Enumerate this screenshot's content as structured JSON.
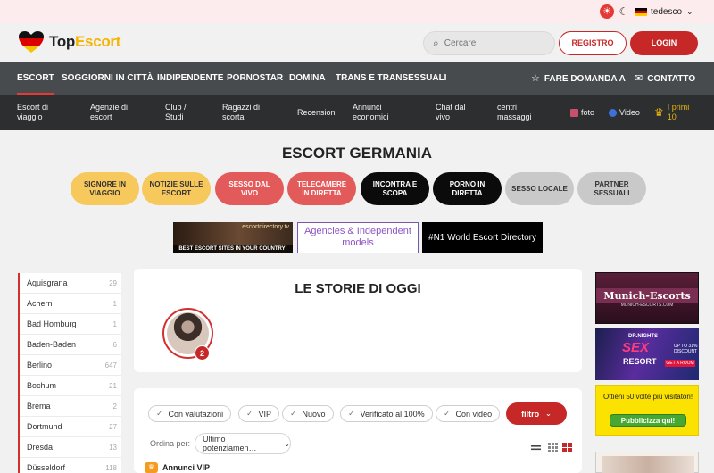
{
  "topbar": {
    "language": "tedesco"
  },
  "header": {
    "logo_part1": "Top",
    "logo_part2": "Escort",
    "search_placeholder": "Cercare",
    "register_label": "REGISTRO",
    "login_label": "LOGIN"
  },
  "nav": {
    "items": [
      "ESCORT",
      "SOGGIORNI IN CITTÀ",
      "INDIPENDENTE",
      "PORNOSTAR",
      "DOMINA",
      "TRANS E TRANSESSUALI"
    ],
    "ask_label": "FARE DOMANDA A",
    "contact_label": "CONTATTO"
  },
  "subnav": {
    "items": [
      "Escort di viaggio",
      "Agenzie di escort",
      "Club / Studi",
      "Ragazzi di scorta",
      "Recensioni",
      "Annunci economici",
      "Chat dal vivo",
      "centri massaggi"
    ],
    "foto_label": "foto",
    "video_label": "Video",
    "top10_label": "I primi 10"
  },
  "page": {
    "title": "ESCORT GERMANIA"
  },
  "pills": [
    "SIGNORE IN VIAGGIO",
    "NOTIZIE SULLE ESCORT",
    "SESSO DAL VIVO",
    "TELECAMERE IN DIRETTA",
    "INCONTRA E SCOPA",
    "PORNO IN DIRETTA",
    "SESSO LOCALE",
    "PARTNER SESSUALI"
  ],
  "banners": {
    "b1_top": "escortdirectory.tv",
    "b1_bottom": "BEST ESCORT SITES IN YOUR COUNTRY!",
    "b2": "Agencies & Independent models",
    "b3": "#N1 World Escort Directory"
  },
  "cities": [
    {
      "name": "Aquisgrana",
      "count": "29"
    },
    {
      "name": "Achern",
      "count": "1"
    },
    {
      "name": "Bad Homburg",
      "count": "1"
    },
    {
      "name": "Baden-Baden",
      "count": "6"
    },
    {
      "name": "Berlino",
      "count": "647"
    },
    {
      "name": "Bochum",
      "count": "21"
    },
    {
      "name": "Brema",
      "count": "2"
    },
    {
      "name": "Dortmund",
      "count": "27"
    },
    {
      "name": "Dresda",
      "count": "13"
    },
    {
      "name": "Düsseldorf",
      "count": "118"
    }
  ],
  "stories": {
    "title": "LE STORIE DI OGGI",
    "badge": "2"
  },
  "filters": {
    "chips": [
      "Con valutazioni",
      "VIP",
      "Nuovo",
      "Verificato al 100%",
      "Con video"
    ],
    "filter_button": "filtro",
    "sort_label": "Ordina per:",
    "sort_value": "Ultimo potenziamen…",
    "vip_heading": "Annunci VIP"
  },
  "ads": {
    "munich_title": "Munich-Escorts",
    "munich_sub": "MUNICH-ESCORTS.COM",
    "sex_top": "DR.NIGHTS",
    "sex_main": "SEX",
    "sex_sub": "RESORT",
    "sex_promo": "UP TO 31% DISCOUNT",
    "sex_cta": "GET A ROOM",
    "yellow_text": "Ottieni 50 volte più visitatori!",
    "yellow_button": "Pubblicizza qui!"
  },
  "colors": {
    "accent_red": "#c62828",
    "pill_yellow": "#f7c85c",
    "logo_gold": "#f5b400"
  }
}
